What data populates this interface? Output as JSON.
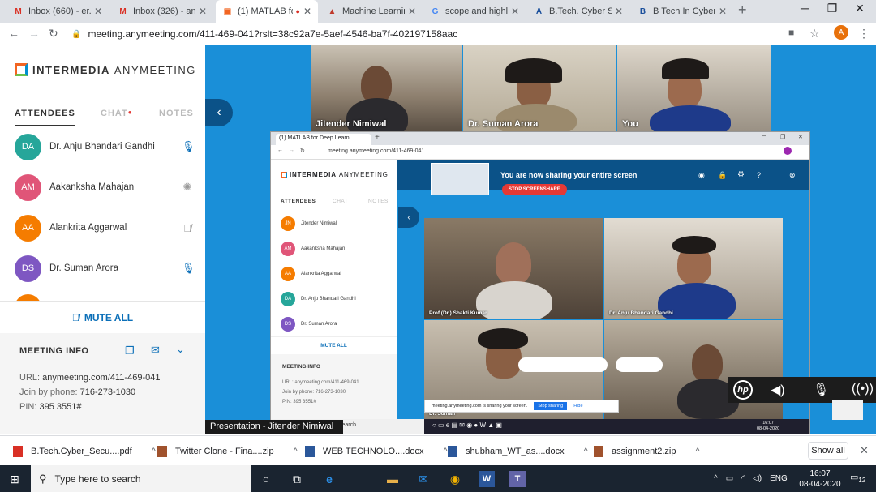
{
  "browser": {
    "tabs": [
      {
        "label": "Inbox (660) - er.an",
        "icon": "gmail-icon",
        "color": "#d93025",
        "glyph": "M"
      },
      {
        "label": "Inbox (326) - anju",
        "icon": "gmail-icon",
        "color": "#d93025",
        "glyph": "M"
      },
      {
        "label": "(1) MATLAB fo",
        "icon": "anymeeting-icon",
        "color": "#f26522",
        "glyph": "▣"
      },
      {
        "label": "Machine Learning",
        "icon": "matlab-icon",
        "color": "#c0392b",
        "glyph": "▲"
      },
      {
        "label": "scope and highligh",
        "icon": "google-icon",
        "color": "#4285f4",
        "glyph": "G"
      },
      {
        "label": "B.Tech. Cyber Secu",
        "icon": "document-icon",
        "color": "#1a4f9c",
        "glyph": "A"
      },
      {
        "label": "B Tech In Cyber Se",
        "icon": "bookmark-icon",
        "color": "#1a4f9c",
        "glyph": "B"
      }
    ],
    "url": "meeting.anymeeting.com/411-469-041?rslt=38c92a7e-5aef-4546-ba7f-402197158aac",
    "profile_initial": "A"
  },
  "left_panel": {
    "brand_bold": "INTERMEDIA",
    "brand_light": "ANYMEETING",
    "tabs": {
      "attendees": "ATTENDEES",
      "chat": "CHAT",
      "notes": "NOTES"
    },
    "attendees": [
      {
        "initials": "DA",
        "name": "Dr. Anju Bhandari Gandhi",
        "color": "#26a69a",
        "status": "mic"
      },
      {
        "initials": "AM",
        "name": "Aakanksha Mahajan",
        "color": "#e05578",
        "status": "loading"
      },
      {
        "initials": "AA",
        "name": "Alankrita Aggarwal",
        "color": "#f57c00",
        "status": "mic-muted"
      },
      {
        "initials": "DS",
        "name": "Dr. Suman Arora",
        "color": "#7e57c2",
        "status": "mic"
      }
    ],
    "mute_all": "MUTE ALL",
    "meeting_info": {
      "title": "MEETING INFO",
      "url_label": "URL:",
      "url_value": "anymeeting.com/411-469-041",
      "phone_label": "Join by phone:",
      "phone_value": "716-273-1030",
      "pin_label": "PIN:",
      "pin_value": "395 3551#"
    }
  },
  "video_strip": [
    {
      "name": "Jitender Nimiwal"
    },
    {
      "name": "Dr. Suman Arora"
    },
    {
      "name": "You"
    }
  ],
  "shared_screen": {
    "tab_title": "(1) MATLAB for Deep Learni...",
    "url": "meeting.anymeeting.com/411-469-041",
    "sharing_text": "You are now sharing your entire screen",
    "stop_button": "STOP SCREENSHARE",
    "brand_bold": "INTERMEDIA",
    "brand_light": "ANYMEETING",
    "tabs": {
      "attendees": "ATTENDEES",
      "chat": "CHAT",
      "notes": "NOTES"
    },
    "attendees": [
      {
        "initials": "JN",
        "name": "Jitender Nimiwal",
        "color": "#f57c00"
      },
      {
        "initials": "AM",
        "name": "Aakanksha Mahajan",
        "color": "#e05578"
      },
      {
        "initials": "AA",
        "name": "Alankrita Aggarwal",
        "color": "#f57c00"
      },
      {
        "initials": "DA",
        "name": "Dr. Anju Bhandari Gandhi",
        "color": "#26a69a"
      },
      {
        "initials": "DS",
        "name": "Dr. Suman Arora",
        "color": "#7e57c2"
      }
    ],
    "mute_all": "MUTE ALL",
    "meeting_info": {
      "title": "MEETING INFO",
      "url": "URL: anymeeting.com/411-469-041",
      "phone": "Join by phone: 716-273-1030",
      "pin": "PIN: 395 3551#"
    },
    "tiles": [
      "Prof.(Dr.) Shakti Kumar",
      "Dr. Anju Bhandari Gandhi",
      "Dr. Suman",
      ""
    ],
    "notice": "meeting.anymeeting.com is sharing your screen.",
    "stop_sharing": "Stop sharing",
    "hide": "Hide",
    "search": "search",
    "clock_time": "16:07",
    "clock_date": "08-04-2020"
  },
  "presentation_label": "Presentation - Jitender Nimiwal",
  "downloads": [
    {
      "name": "B.Tech.Cyber_Secu....pdf",
      "icon": "pdf-icon",
      "color": "#d93025"
    },
    {
      "name": "Twitter Clone - Fina....zip",
      "icon": "zip-icon",
      "color": "#a0522d"
    },
    {
      "name": "WEB TECHNOLO....docx",
      "icon": "docx-icon",
      "color": "#2b579a"
    },
    {
      "name": "shubham_WT_as....docx",
      "icon": "docx-icon",
      "color": "#2b579a"
    },
    {
      "name": "assignment2.zip",
      "icon": "zip-icon",
      "color": "#a0522d"
    }
  ],
  "show_all": "Show all",
  "taskbar": {
    "search_placeholder": "Type here to search",
    "language": "ENG",
    "time": "16:07",
    "date": "08-04-2020",
    "notification_count": "12"
  }
}
